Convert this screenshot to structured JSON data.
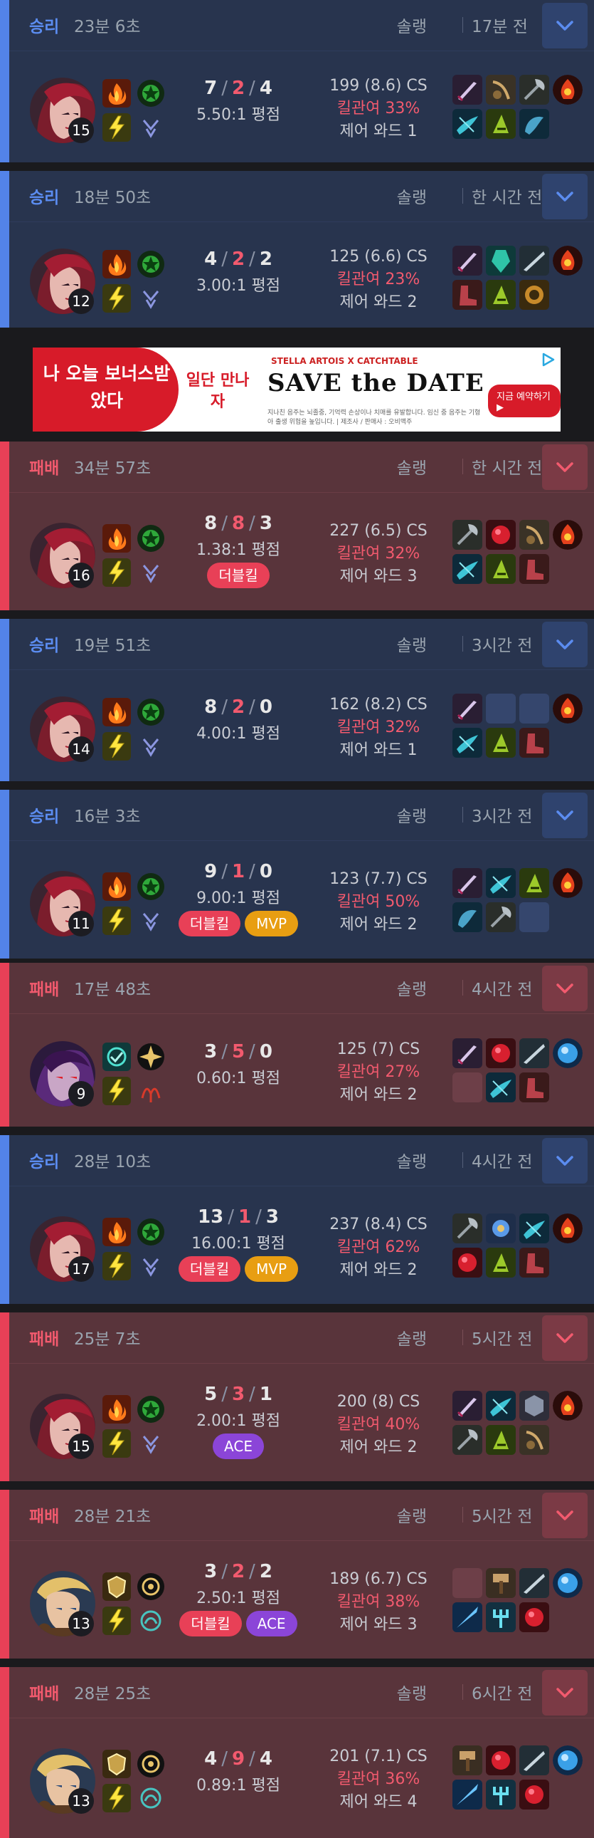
{
  "labels": {
    "avg": "평점"
  },
  "ad": {
    "left_text": "나 오늘 보너스받았다",
    "tag": "일단 만나자",
    "brand": "STELLA ARTOIS X CATCHTABLE",
    "headline": "SAVE the DATE",
    "fine": "지나친 음주는 뇌졸중, 기억력 손상이나 치매를 유발합니다. 임신 중 음주는 기형아 출생 위험을 높입니다. | 제조사 / 판매사 : 오비맥주",
    "cta": "지금 예약하기 ▶"
  },
  "matches": [
    {
      "result": "승리",
      "duration": "23분 6초",
      "queue": "솔랭",
      "ago": "17분 전",
      "level": "15",
      "k": "7",
      "d": "2",
      "a": "4",
      "ratio": "5.50:1",
      "cs": "199 (8.6) CS",
      "kp": "킬관여 33%",
      "wards": "제어 와드 1",
      "badges": []
    },
    {
      "result": "승리",
      "duration": "18분 50초",
      "queue": "솔랭",
      "ago": "한 시간 전",
      "level": "12",
      "k": "4",
      "d": "2",
      "a": "2",
      "ratio": "3.00:1",
      "cs": "125 (6.6) CS",
      "kp": "킬관여 23%",
      "wards": "제어 와드 2",
      "badges": []
    },
    {
      "result": "패배",
      "duration": "34분 57초",
      "queue": "솔랭",
      "ago": "한 시간 전",
      "level": "16",
      "k": "8",
      "d": "8",
      "a": "3",
      "ratio": "1.38:1",
      "cs": "227 (6.5) CS",
      "kp": "킬관여 32%",
      "wards": "제어 와드 3",
      "badges": [
        "더블킬"
      ]
    },
    {
      "result": "승리",
      "duration": "19분 51초",
      "queue": "솔랭",
      "ago": "3시간 전",
      "level": "14",
      "k": "8",
      "d": "2",
      "a": "0",
      "ratio": "4.00:1",
      "cs": "162 (8.2) CS",
      "kp": "킬관여 32%",
      "wards": "제어 와드 1",
      "badges": []
    },
    {
      "result": "승리",
      "duration": "16분 3초",
      "queue": "솔랭",
      "ago": "3시간 전",
      "level": "11",
      "k": "9",
      "d": "1",
      "a": "0",
      "ratio": "9.00:1",
      "cs": "123 (7.7) CS",
      "kp": "킬관여 50%",
      "wards": "제어 와드 2",
      "badges": [
        "더블킬",
        "MVP"
      ]
    },
    {
      "result": "패배",
      "duration": "17분 48초",
      "queue": "솔랭",
      "ago": "4시간 전",
      "level": "9",
      "k": "3",
      "d": "5",
      "a": "0",
      "ratio": "0.60:1",
      "cs": "125 (7) CS",
      "kp": "킬관여 27%",
      "wards": "제어 와드 2",
      "badges": []
    },
    {
      "result": "승리",
      "duration": "28분 10초",
      "queue": "솔랭",
      "ago": "4시간 전",
      "level": "17",
      "k": "13",
      "d": "1",
      "a": "3",
      "ratio": "16.00:1",
      "cs": "237 (8.4) CS",
      "kp": "킬관여 62%",
      "wards": "제어 와드 2",
      "badges": [
        "더블킬",
        "MVP"
      ]
    },
    {
      "result": "패배",
      "duration": "25분 7초",
      "queue": "솔랭",
      "ago": "5시간 전",
      "level": "15",
      "k": "5",
      "d": "3",
      "a": "1",
      "ratio": "2.00:1",
      "cs": "200 (8) CS",
      "kp": "킬관여 40%",
      "wards": "제어 와드 2",
      "badges": [
        "ACE"
      ]
    },
    {
      "result": "패배",
      "duration": "28분 21초",
      "queue": "솔랭",
      "ago": "5시간 전",
      "level": "13",
      "k": "3",
      "d": "2",
      "a": "2",
      "ratio": "2.50:1",
      "cs": "189 (6.7) CS",
      "kp": "킬관여 38%",
      "wards": "제어 와드 3",
      "badges": [
        "더블킬",
        "ACE"
      ]
    },
    {
      "result": "패배",
      "duration": "28분 25초",
      "queue": "솔랭",
      "ago": "6시간 전",
      "level": "13",
      "k": "4",
      "d": "9",
      "a": "4",
      "ratio": "0.89:1",
      "cs": "201 (7.1) CS",
      "kp": "킬관여 36%",
      "wards": "제어 와드 4",
      "badges": []
    }
  ]
}
